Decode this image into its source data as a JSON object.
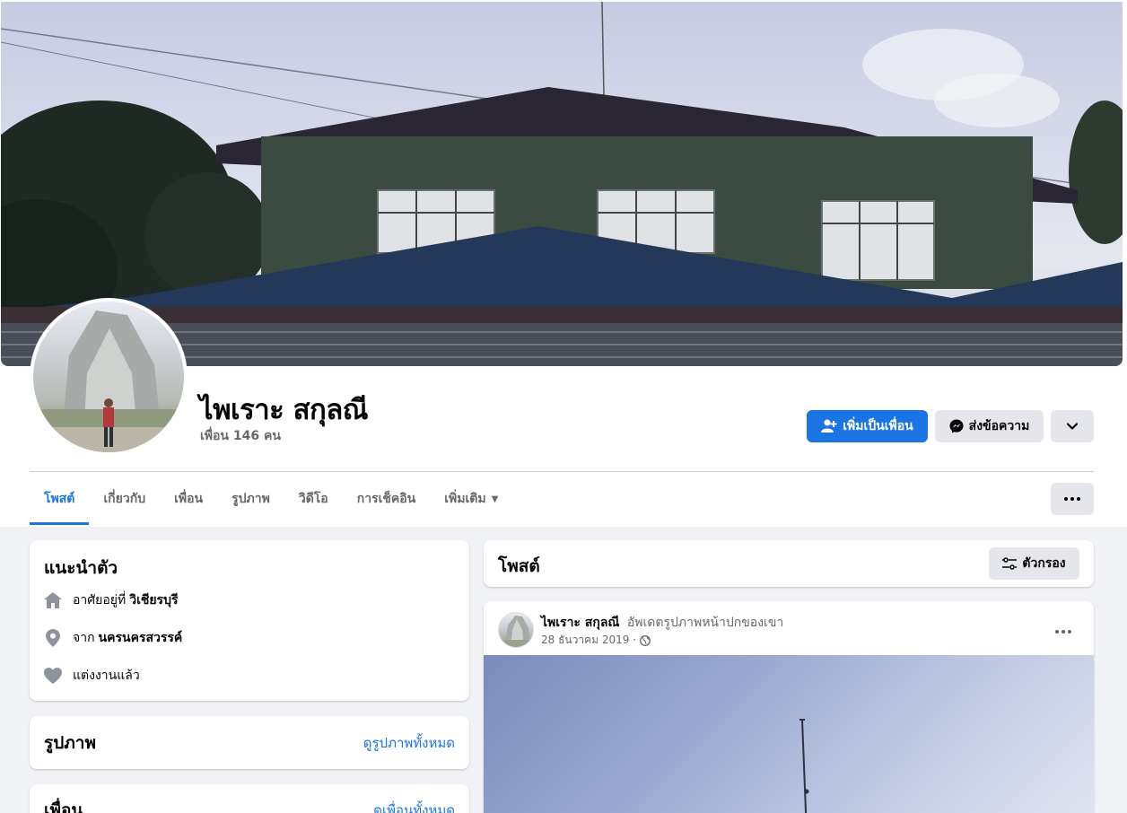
{
  "profile": {
    "name": "ไพเราะ สกุลณี",
    "friend_count": "เพื่อน 146 คน"
  },
  "actions": {
    "add_friend": "เพิ่มเป็นเพื่อน",
    "message": "ส่งข้อความ"
  },
  "tabs": [
    {
      "label": "โพสต์",
      "active": true
    },
    {
      "label": "เกี่ยวกับ"
    },
    {
      "label": "เพื่อน"
    },
    {
      "label": "รูปภาพ"
    },
    {
      "label": "วิดีโอ"
    },
    {
      "label": "การเช็คอิน"
    },
    {
      "label": "เพิ่มเติม"
    }
  ],
  "intro": {
    "title": "แนะนำตัว",
    "lives_prefix": "อาศัยอยู่ที่",
    "lives_place": "วิเชียรบุรี",
    "from_prefix": "จาก",
    "from_place": "นครนครสวรรค์",
    "relationship": "แต่งงานแล้ว"
  },
  "photos": {
    "title": "รูปภาพ",
    "link": "ดูรูปภาพทั้งหมด"
  },
  "friends": {
    "title": "เพื่อน",
    "link": "ดูเพื่อนทั้งหมด"
  },
  "posts": {
    "title": "โพสต์",
    "filter": "ตัวกรอง"
  },
  "post": {
    "author": "ไพเราะ สกุลณี",
    "action": "อัพเดตรูปภาพหน้าปกของเขา",
    "date": "28 ธันวาคม 2019 ·"
  },
  "colors": {
    "accent": "#1b74e4",
    "background": "#f0f2f5",
    "secondary_button": "#e4e6eb"
  }
}
